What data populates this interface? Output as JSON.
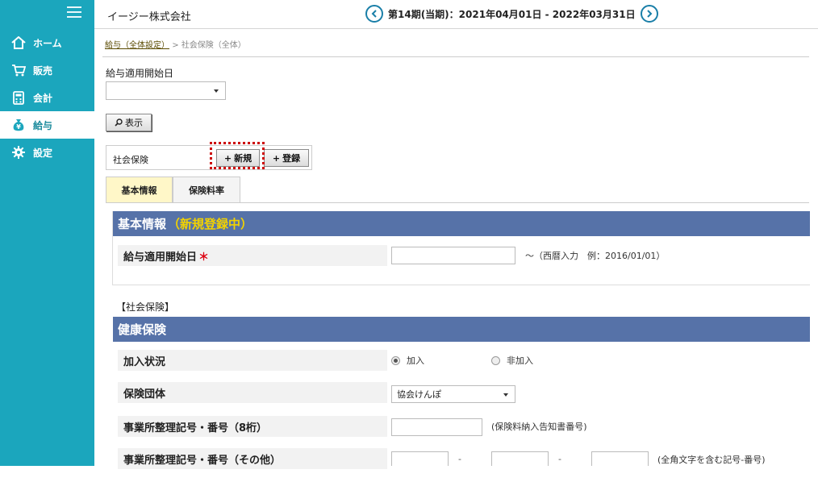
{
  "sidebar": {
    "items": [
      {
        "label": "ホーム",
        "icon": "home-icon"
      },
      {
        "label": "販売",
        "icon": "cart-icon"
      },
      {
        "label": "会計",
        "icon": "calculator-icon"
      },
      {
        "label": "給与",
        "icon": "money-bag-icon"
      },
      {
        "label": "設定",
        "icon": "gear-icon"
      }
    ],
    "active_index": 3,
    "color": "#1ba6bd"
  },
  "header": {
    "company": "イージー株式会社",
    "period": "第14期(当期)：2021年04月01日 - 2022年03月31日"
  },
  "breadcrumb": {
    "link": "給与（全体設定）",
    "separator": ">",
    "current": "社会保険（全体）"
  },
  "filter": {
    "start_label": "給与適用開始日",
    "start_value": "",
    "show_button": "表示"
  },
  "toolbar": {
    "label": "社会保険",
    "new_button": "新規",
    "register_button": "登録"
  },
  "tabs": [
    {
      "label": "基本情報",
      "active": true
    },
    {
      "label": "保険料率",
      "active": false
    }
  ],
  "basic": {
    "title": "基本情報",
    "status": "（新規登録中）",
    "date_label": "給与適用開始日",
    "required_mark": "＊",
    "date_value": "",
    "date_hint": "～（西暦入力　例：2016/01/01）"
  },
  "social": {
    "section_label": "【社会保険】",
    "health_title": "健康保険",
    "join_label": "加入状況",
    "join_options": [
      "加入",
      "非加入"
    ],
    "join_selected": 0,
    "group_label": "保険団体",
    "group_value": "協会けんぽ",
    "office8_label": "事業所整理記号・番号（8桁）",
    "office8_hint": "(保険料納入告知書番号)",
    "office_other_label": "事業所整理記号・番号（その他）",
    "office_other_sep": "-",
    "office_other_hint": "(全角文字を含む記号-番号)"
  },
  "colors": {
    "header_bar": "#5672a8",
    "highlight": "#f2d200",
    "active_tab": "#fff7c8",
    "marker": "#cc0000"
  }
}
